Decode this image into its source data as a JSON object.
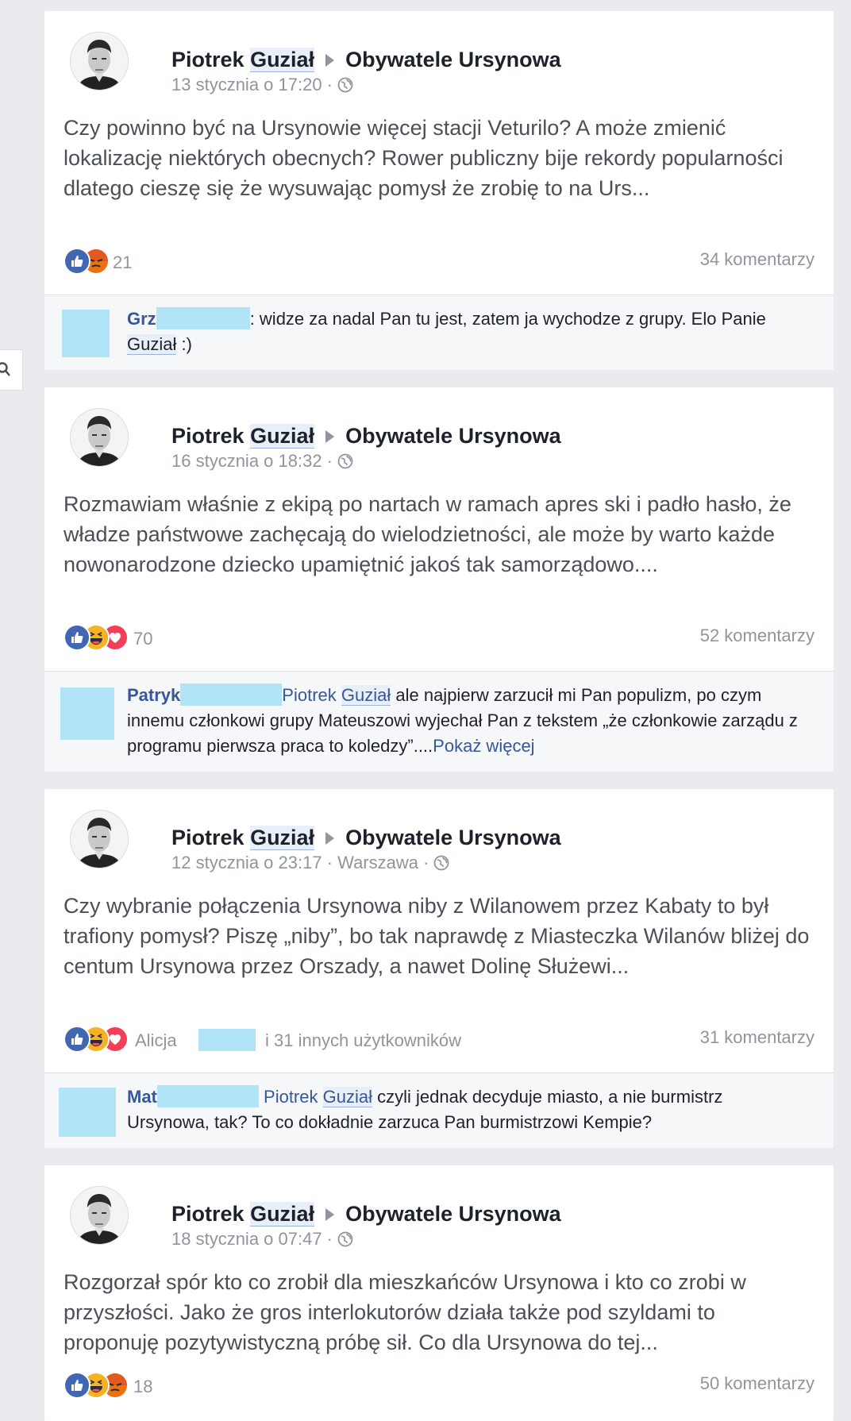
{
  "search_icon": "search-icon",
  "posts": [
    {
      "author_first": "Piotrek",
      "author_last": "Guział",
      "group": "Obywatele Ursynowa",
      "time": "13 stycznia o 17:20 ·",
      "text": "Czy powinno być na Ursynowie więcej stacji Veturilo? A może zmienić lokalizację niektórych obecnych? Rower publiczny bije rekordy popularności dlatego cieszę się że wysuwając pomysł że zrobię to na Urs...",
      "reactions": [
        "like",
        "angry"
      ],
      "reaction_count": "21",
      "comments": "34 komentarzy",
      "comment": {
        "name": "Grz",
        "text_a": ": widze za nadal Pan tu jest, zatem ja wychodze z grupy. Elo Panie ",
        "text_b_highlight": "Guział",
        "text_c": " :)"
      }
    },
    {
      "author_first": "Piotrek",
      "author_last": "Guział",
      "group": "Obywatele Ursynowa",
      "time": "16 stycznia o 18:32 ·",
      "text": "Rozmawiam właśnie z ekipą po nartach w ramach apres ski i padło hasło, że władze państwowe zachęcają do wielodzietności, ale może by warto każde nowonarodzone dziecko upamiętnić jakoś tak samorządowo....",
      "reactions": [
        "like",
        "haha",
        "love"
      ],
      "reaction_count": "70",
      "comments": "52 komentarzy",
      "comment": {
        "name": "Patryk",
        "mention_first": "Piotrek",
        "mention_last": "Guział",
        "text": " ale najpierw zarzucił mi Pan populizm, po czym innemu członkowi grupy Mateuszowi wyjechał Pan z tekstem „że członkowie zarządu z programu pierwsza praca to koledzy”....",
        "more": "Pokaż więcej"
      }
    },
    {
      "author_first": "Piotrek",
      "author_last": "Guział",
      "group": "Obywatele Ursynowa",
      "time": "12 stycznia o 23:17 · Warszawa ·",
      "text": "Czy wybranie połączenia Ursynowa niby z Wilanowem przez Kabaty to był trafiony pomysł? Piszę „niby”, bo tak naprawdę z Miasteczka Wilanów bliżej do centum Ursynowa przez Orszady, a nawet Dolinę Służewi...",
      "reactions": [
        "like",
        "haha",
        "love"
      ],
      "reaction_name": "Alicja",
      "reaction_others": "i 31 innych użytkowników",
      "comments": "31 komentarzy",
      "comment": {
        "name": "Mat",
        "mention_first": "Piotrek",
        "mention_last": "Guział",
        "text": " czyli jednak decyduje miasto, a nie burmistrz Ursynowa, tak? To co dokładnie zarzuca Pan burmistrzowi Kempie?"
      }
    },
    {
      "author_first": "Piotrek",
      "author_last": "Guział",
      "group": "Obywatele Ursynowa",
      "time": "18 stycznia o 07:47 ·",
      "text": "Rozgorzał spór kto co zrobił dla mieszkańców Ursynowa i kto co zrobi w przyszłości. Jako że gros interlokutorów działa także pod szyldami to proponuję pozytywistyczną próbę sił. Co dla Ursynowa do tej...",
      "reactions": [
        "like",
        "haha",
        "angry"
      ],
      "reaction_count": "18",
      "comments": "50 komentarzy"
    }
  ],
  "colors": {
    "like": "#4267b2",
    "love": "#f33e58",
    "haha": "#f7b125",
    "angry": "#e9710f",
    "link": "#365899"
  }
}
